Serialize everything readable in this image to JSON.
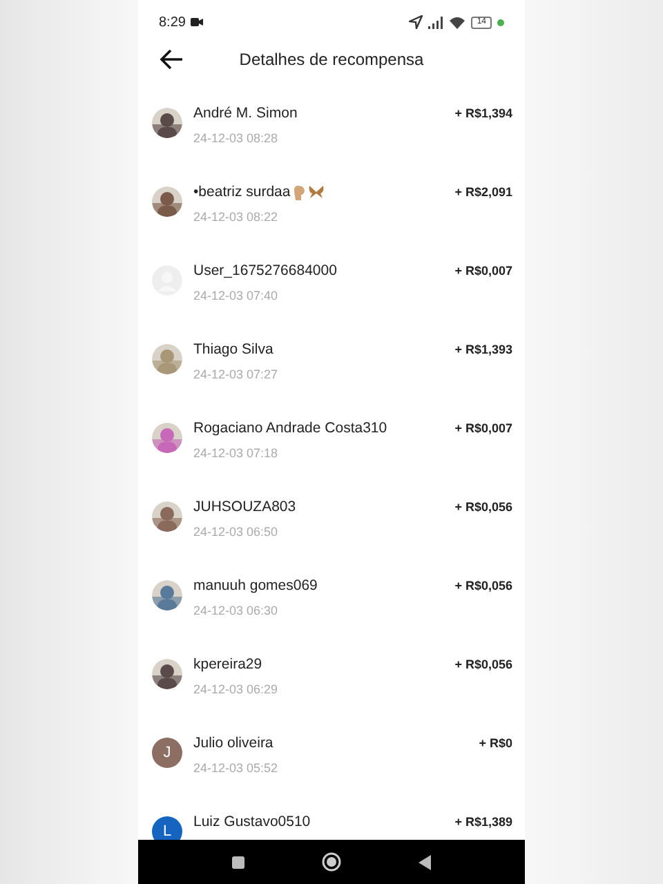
{
  "status_bar": {
    "time": "8:29",
    "battery": "14"
  },
  "header": {
    "title": "Detalhes de recompensa"
  },
  "rows": [
    {
      "name": "André M. Simon",
      "date": "24-12-03 08:28",
      "amount": "+ R$1,394"
    },
    {
      "name": "•beatriz surdaa",
      "date": "24-12-03 08:22",
      "amount": "+ R$2,091",
      "trailing_icons": [
        {
          "kind": "hand"
        },
        {
          "kind": "butterfly"
        }
      ]
    },
    {
      "name": "User_1675276684000",
      "date": "24-12-03 07:40",
      "amount": "+ R$0,007",
      "avatar": {
        "kind": "blank"
      }
    },
    {
      "name": "Thiago Silva",
      "date": "24-12-03 07:27",
      "amount": "+ R$1,393"
    },
    {
      "name": "Rogaciano Andrade Costa310",
      "date": "24-12-03 07:18",
      "amount": "+ R$0,007"
    },
    {
      "name": "JUHSOUZA803",
      "date": "24-12-03 06:50",
      "amount": "+ R$0,056"
    },
    {
      "name": "manuuh gomes069",
      "date": "24-12-03 06:30",
      "amount": "+ R$0,056"
    },
    {
      "name": "kpereira29",
      "date": "24-12-03 06:29",
      "amount": "+ R$0,056"
    },
    {
      "name": "Julio oliveira",
      "date": "24-12-03 05:52",
      "amount": "+ R$0",
      "avatar": {
        "kind": "letter",
        "letter": "J",
        "color": "#8d6e63"
      }
    },
    {
      "name": "Luiz Gustavo0510",
      "amount": "+ R$1,389",
      "avatar": {
        "kind": "letter",
        "letter": "L",
        "color": "#1565c0"
      }
    }
  ]
}
